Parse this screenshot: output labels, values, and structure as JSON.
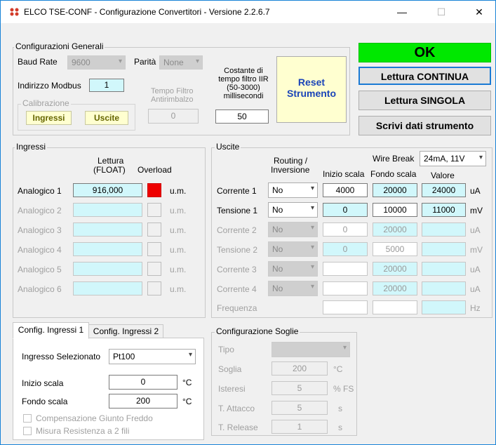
{
  "window": {
    "title": "ELCO TSE-CONF - Configurazione Convertitori - Versione 2.2.6.7",
    "minimize": "—",
    "maximize": "☐",
    "close": "✕"
  },
  "config_generali": {
    "title": "Configurazioni Generali",
    "baud_label": "Baud Rate",
    "baud_value": "9600",
    "parita_label": "Parità",
    "parita_value": "None",
    "modbus_label": "Indirizzo Modbus",
    "modbus_value": "1",
    "calib_title": "Calibrazione",
    "ingressi_btn": "Ingressi",
    "uscite_btn": "Uscite",
    "filtro_label_1": "Tempo Filtro",
    "filtro_label_2": "Antirimbalzo",
    "filtro_value": "0",
    "iir_label_1": "Costante di",
    "iir_label_2": "tempo filtro IIR",
    "iir_label_3": "(50-3000)",
    "iir_label_4": "millisecondi",
    "iir_value": "50",
    "reset_1": "Reset",
    "reset_2": "Strumento"
  },
  "status": {
    "text": "OK",
    "color": "#00e800"
  },
  "buttons": {
    "lettura_continua": "Lettura CONTINUA",
    "lettura_singola": "Lettura SINGOLA",
    "scrivi": "Scrivi dati strumento"
  },
  "ingressi": {
    "title": "Ingressi",
    "col_lettura_1": "Lettura",
    "col_lettura_2": "(FLOAT)",
    "col_overload": "Overload",
    "rows": [
      {
        "label": "Analogico 1",
        "value": "916,000",
        "unit": "u.m."
      },
      {
        "label": "Analogico 2",
        "value": "",
        "unit": "u.m."
      },
      {
        "label": "Analogico 3",
        "value": "",
        "unit": "u.m."
      },
      {
        "label": "Analogico 4",
        "value": "",
        "unit": "u.m."
      },
      {
        "label": "Analogico 5",
        "value": "",
        "unit": "u.m."
      },
      {
        "label": "Analogico 6",
        "value": "",
        "unit": "u.m."
      }
    ]
  },
  "uscite": {
    "title": "Uscite",
    "routing_1": "Routing /",
    "routing_2": "Inversione",
    "wire_break_label": "Wire Break",
    "wire_break_value": "24mA, 11V",
    "col_inizio": "Inizio scala",
    "col_fondo": "Fondo scala",
    "col_valore": "Valore",
    "rows": [
      {
        "label": "Corrente 1",
        "routing": "No",
        "inizio": "4000",
        "fondo": "20000",
        "valore": "24000",
        "unit": "uA"
      },
      {
        "label": "Tensione 1",
        "routing": "No",
        "inizio": "0",
        "fondo": "10000",
        "valore": "11000",
        "unit": "mV"
      },
      {
        "label": "Corrente 2",
        "routing": "No",
        "inizio": "0",
        "fondo": "20000",
        "valore": "",
        "unit": "uA"
      },
      {
        "label": "Tensione 2",
        "routing": "No",
        "inizio": "0",
        "fondo": "5000",
        "valore": "",
        "unit": "mV"
      },
      {
        "label": "Corrente 3",
        "routing": "No",
        "inizio": "",
        "fondo": "20000",
        "valore": "",
        "unit": "uA"
      },
      {
        "label": "Corrente 4",
        "routing": "No",
        "inizio": "",
        "fondo": "20000",
        "valore": "",
        "unit": "uA"
      },
      {
        "label": "Frequenza",
        "routing": "",
        "inizio": "",
        "fondo": "",
        "valore": "",
        "unit": "Hz"
      }
    ]
  },
  "config_ingressi": {
    "tab1": "Config. Ingressi 1",
    "tab2": "Config. Ingressi 2",
    "sel_label": "Ingresso Selezionato",
    "sel_value": "Pt100",
    "inizio_label": "Inizio scala",
    "inizio_value": "0",
    "inizio_unit": "°C",
    "fondo_label": "Fondo scala",
    "fondo_value": "200",
    "fondo_unit": "°C",
    "chk1": "Compensazione Giunto Freddo",
    "chk2": "Misura Resistenza a 2 fili"
  },
  "soglie": {
    "title": "Configurazione Soglie",
    "tipo_label": "Tipo",
    "soglia_label": "Soglia",
    "soglia_value": "200",
    "soglia_unit": "°C",
    "isteresi_label": "Isteresi",
    "isteresi_value": "5",
    "isteresi_unit": "% FS",
    "attacco_label": "T. Attacco",
    "attacco_value": "5",
    "attacco_unit": "s",
    "release_label": "T. Release",
    "release_value": "1",
    "release_unit": "s"
  }
}
